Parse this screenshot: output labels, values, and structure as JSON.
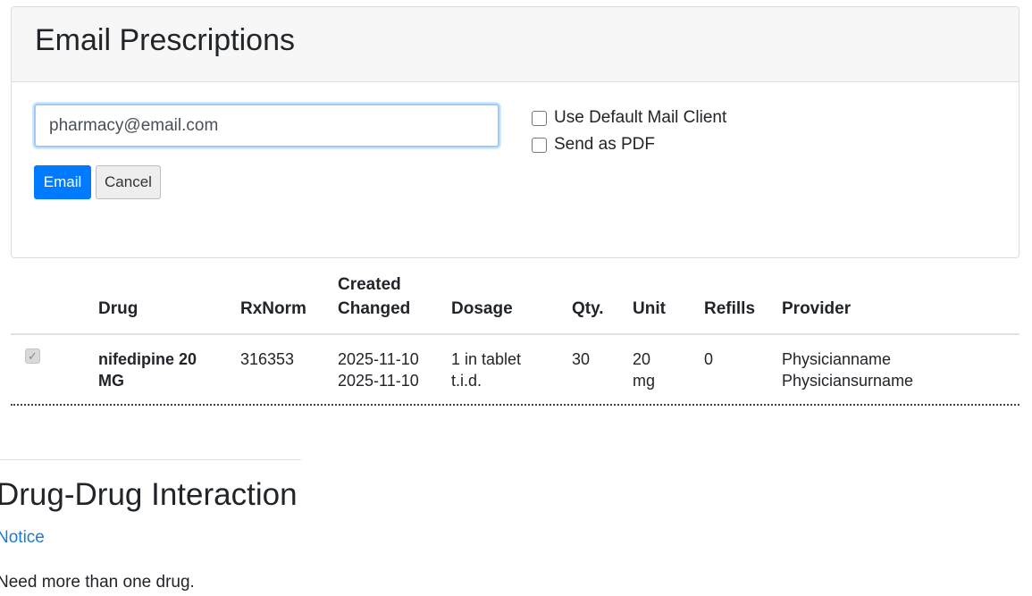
{
  "panel": {
    "title": "Email Prescriptions",
    "email_value": "pharmacy@email.com",
    "email_button": "Email",
    "cancel_button": "Cancel",
    "options": [
      {
        "label": "Use Default Mail Client",
        "checked": false
      },
      {
        "label": "Send as PDF",
        "checked": false
      }
    ]
  },
  "table": {
    "headers": {
      "drug": "Drug",
      "rxnorm": "RxNorm",
      "created": "Created",
      "changed": "Changed",
      "dosage": "Dosage",
      "qty": "Qty.",
      "unit": "Unit",
      "refills": "Refills",
      "provider": "Provider"
    },
    "rows": [
      {
        "checked": true,
        "drug_line1": "nifedipine 20",
        "drug_line2": "MG",
        "rxnorm": "316353",
        "created": "2025-11-10",
        "changed": "2025-11-10",
        "dosage_line1": "1 in tablet",
        "dosage_line2": "t.i.d.",
        "qty": "30",
        "unit_line1": "20",
        "unit_line2": "mg",
        "refills": "0",
        "provider_line1": "Physicianname",
        "provider_line2": "Physiciansurname"
      }
    ]
  },
  "interaction": {
    "title": "Drug-Drug Interaction",
    "notice_link": "Notice",
    "message": "Need more than one drug."
  },
  "colors": {
    "accent": "#007bff",
    "link": "#1a7bd1",
    "header_bg": "#f7f7f7"
  }
}
